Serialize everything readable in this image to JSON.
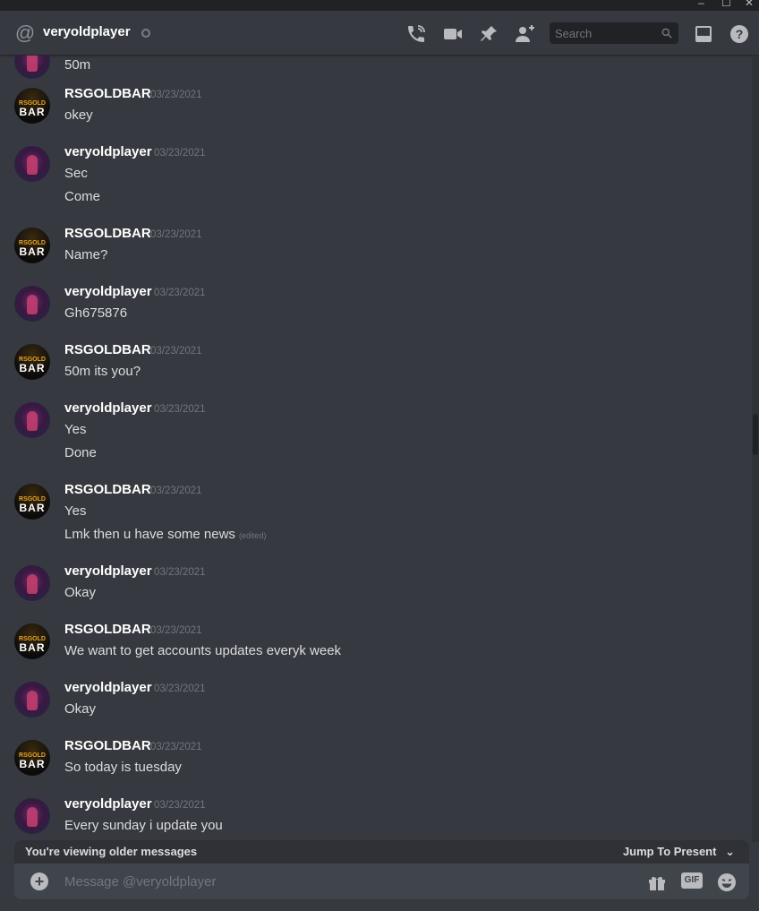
{
  "header": {
    "channel_name": "veryoldplayer",
    "search_placeholder": "Search"
  },
  "messages": [
    {
      "text": "50m"
    },
    {
      "author": "RSGOLDBAR",
      "timestamp": "03/23/2021",
      "lines": [
        "okey"
      ]
    },
    {
      "author": "veryoldplayer",
      "timestamp": "03/23/2021",
      "lines": [
        "Sec",
        "Come"
      ]
    },
    {
      "author": "RSGOLDBAR",
      "timestamp": "03/23/2021",
      "lines": [
        "Name?"
      ]
    },
    {
      "author": "veryoldplayer",
      "timestamp": "03/23/2021",
      "lines": [
        "Gh675876"
      ]
    },
    {
      "author": "RSGOLDBAR",
      "timestamp": "03/23/2021",
      "lines": [
        "50m its you?"
      ]
    },
    {
      "author": "veryoldplayer",
      "timestamp": "03/23/2021",
      "lines": [
        "Yes",
        "Done"
      ]
    },
    {
      "author": "RSGOLDBAR",
      "timestamp": "03/23/2021",
      "lines": [
        "Yes",
        "Lmk then u have some news"
      ],
      "edited": "(edited)"
    },
    {
      "author": "veryoldplayer",
      "timestamp": "03/23/2021",
      "lines": [
        "Okay"
      ]
    },
    {
      "author": "RSGOLDBAR",
      "timestamp": "03/23/2021",
      "lines": [
        "We want to get accounts updates everyk week"
      ]
    },
    {
      "author": "veryoldplayer",
      "timestamp": "03/23/2021",
      "lines": [
        "Okay"
      ]
    },
    {
      "author": "RSGOLDBAR",
      "timestamp": "03/23/2021",
      "lines": [
        "So today is tuesday"
      ]
    },
    {
      "author": "veryoldplayer",
      "timestamp": "03/23/2021",
      "lines": [
        "Every sunday i update you"
      ]
    }
  ],
  "avatar": {
    "rsgold_line1": "RSGOLD",
    "rsgold_line2": "BAR"
  },
  "older_bar": {
    "text": "You're viewing older messages",
    "jump": "Jump To Present"
  },
  "composer": {
    "placeholder": "Message @veryoldplayer",
    "gif_label": "GIF"
  },
  "colors": {
    "background": "#36393f",
    "header": "#36393f",
    "composer": "#40444b",
    "older_bar": "#2f3136"
  }
}
